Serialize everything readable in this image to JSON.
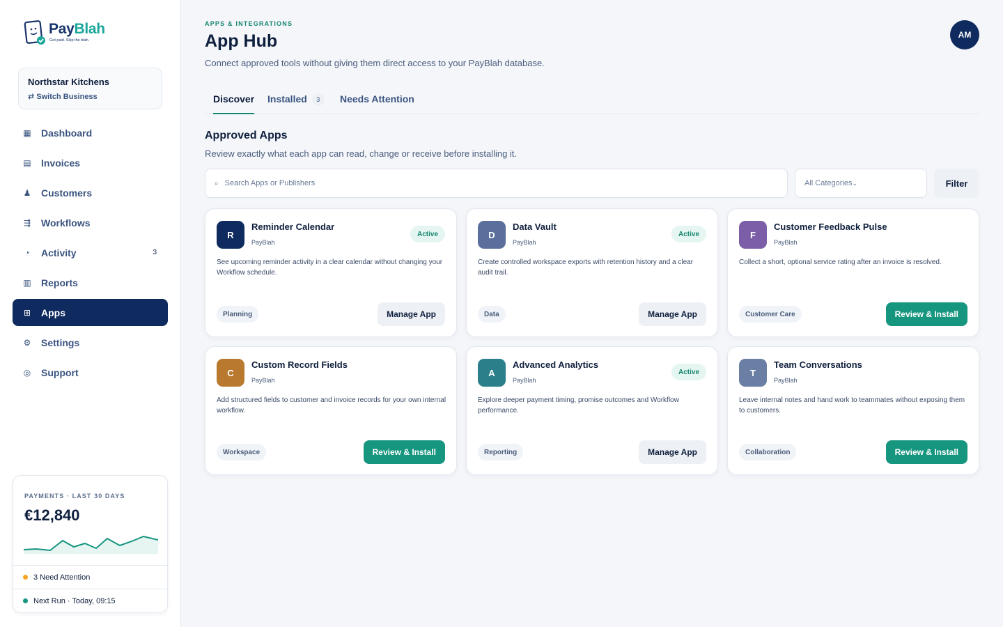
{
  "brand": {
    "name_part1": "Pay",
    "name_part2": "Blah",
    "tagline": "Get paid. Skip the blah."
  },
  "business": {
    "name": "Northstar Kitchens",
    "switch_label": "⇄ Switch Business"
  },
  "nav": {
    "items": [
      {
        "label": "Dashboard",
        "icon": "grid-icon",
        "glyph": "▦"
      },
      {
        "label": "Invoices",
        "icon": "invoice-icon",
        "glyph": "▤"
      },
      {
        "label": "Customers",
        "icon": "person-icon",
        "glyph": "♟"
      },
      {
        "label": "Workflows",
        "icon": "workflow-icon",
        "glyph": "⇶"
      },
      {
        "label": "Activity",
        "icon": "clock-icon",
        "glyph": "◔",
        "badge": "3"
      },
      {
        "label": "Reports",
        "icon": "bar-chart-icon",
        "glyph": "▥"
      },
      {
        "label": "Apps",
        "icon": "apps-icon",
        "glyph": "⊞",
        "active": true
      },
      {
        "label": "Settings",
        "icon": "gear-icon",
        "glyph": "⚙"
      },
      {
        "label": "Support",
        "icon": "support-icon",
        "glyph": "◎"
      }
    ]
  },
  "payments": {
    "heading": "PAYMENTS · LAST 30 DAYS",
    "amount": "€12,840",
    "attention": "3 Need Attention",
    "next_run": "Next Run · Today, 09:15",
    "attention_color": "#f5a623",
    "next_run_color": "#16957f"
  },
  "header": {
    "eyebrow": "APPS & INTEGRATIONS",
    "title": "App Hub",
    "subtitle": "Connect approved tools without giving them direct access to your PayBlah database.",
    "avatar_initials": "AM"
  },
  "tabs": [
    {
      "label": "Discover",
      "active": true
    },
    {
      "label": "Installed",
      "count": "3"
    },
    {
      "label": "Needs Attention"
    }
  ],
  "section": {
    "title": "Approved Apps",
    "subtitle": "Review exactly what each app can read, change or receive before installing it."
  },
  "search": {
    "placeholder": "Search Apps or Publishers",
    "category_value": "All Categories",
    "filter_label": "Filter"
  },
  "apps": [
    {
      "letter": "R",
      "color": "#0e2a5e",
      "name": "Reminder Calendar",
      "publisher": "PayBlah",
      "status": "Active",
      "description": "See upcoming reminder activity in a clear calendar without changing your Workflow schedule.",
      "tag": "Planning",
      "action": "Manage App"
    },
    {
      "letter": "D",
      "color": "#5a6f9c",
      "name": "Data Vault",
      "publisher": "PayBlah",
      "status": "Active",
      "description": "Create controlled workspace exports with retention history and a clear audit trail.",
      "tag": "Data",
      "action": "Manage App"
    },
    {
      "letter": "F",
      "color": "#7b5ea7",
      "name": "Customer Feedback Pulse",
      "publisher": "PayBlah",
      "status": "",
      "description": "Collect a short, optional service rating after an invoice is resolved.",
      "tag": "Customer Care",
      "action": "Review & Install"
    },
    {
      "letter": "C",
      "color": "#b97a2f",
      "name": "Custom Record Fields",
      "publisher": "PayBlah",
      "status": "",
      "description": "Add structured fields to customer and invoice records for your own internal workflow.",
      "tag": "Workspace",
      "action": "Review & Install"
    },
    {
      "letter": "A",
      "color": "#2b7f8a",
      "name": "Advanced Analytics",
      "publisher": "PayBlah",
      "status": "Active",
      "description": "Explore deeper payment timing, promise outcomes and Workflow performance.",
      "tag": "Reporting",
      "action": "Manage App"
    },
    {
      "letter": "T",
      "color": "#6a7fa3",
      "name": "Team Conversations",
      "publisher": "PayBlah",
      "status": "",
      "description": "Leave internal notes and hand work to teammates without exposing them to customers.",
      "tag": "Collaboration",
      "action": "Review & Install"
    }
  ]
}
